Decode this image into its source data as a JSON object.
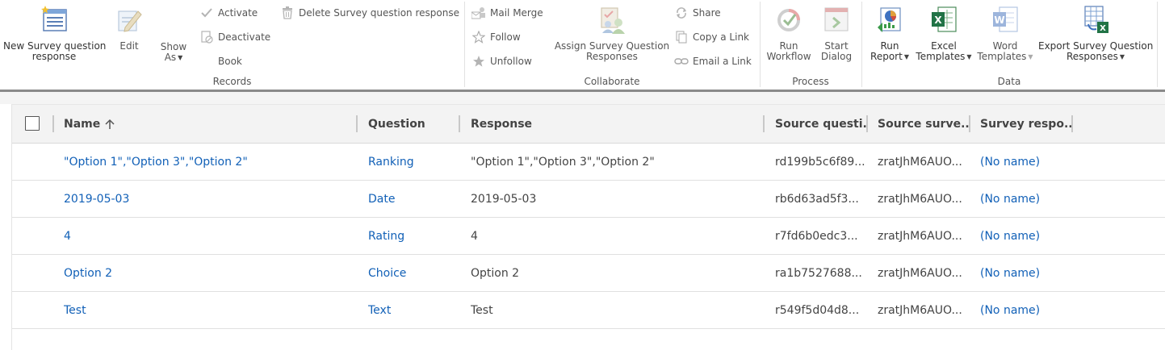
{
  "ribbon": {
    "records": {
      "new_label_line1": "New Survey question",
      "new_label_line2": "response",
      "edit_label": "Edit",
      "show_as_line1": "Show",
      "show_as_line2": "As",
      "activate_label": "Activate",
      "deactivate_label": "Deactivate",
      "book_label": "Book",
      "delete_label": "Delete Survey question response",
      "group_label": "Records"
    },
    "collaborate": {
      "mail_merge_label": "Mail Merge",
      "follow_label": "Follow",
      "unfollow_label": "Unfollow",
      "assign_line1": "Assign Survey Question",
      "assign_line2": "Responses",
      "share_label": "Share",
      "copy_link_label": "Copy a Link",
      "email_link_label": "Email a Link",
      "group_label": "Collaborate"
    },
    "process": {
      "run_workflow_line1": "Run",
      "run_workflow_line2": "Workflow",
      "start_dialog_line1": "Start",
      "start_dialog_line2": "Dialog",
      "group_label": "Process"
    },
    "data": {
      "run_report_line1": "Run",
      "run_report_line2": "Report",
      "excel_line1": "Excel",
      "excel_line2": "Templates",
      "word_line1": "Word",
      "word_line2": "Templates",
      "export_line1": "Export Survey Question",
      "export_line2": "Responses",
      "group_label": "Data"
    }
  },
  "grid": {
    "columns": {
      "name": "Name",
      "question": "Question",
      "response": "Response",
      "source_question": "Source questi...",
      "source_survey": "Source surve...",
      "survey_response": "Survey respo..."
    },
    "sort_icon": "arrow-up-icon",
    "rows": [
      {
        "name": "\"Option 1\",\"Option 3\",\"Option 2\"",
        "question": "Ranking",
        "response": "\"Option 1\",\"Option 3\",\"Option 2\"",
        "source_question": "rd199b5c6f89...",
        "source_survey": "zratJhM6AUO...",
        "survey_response": "(No name)"
      },
      {
        "name": "2019-05-03",
        "question": "Date",
        "response": "2019-05-03",
        "source_question": "rb6d63ad5f3...",
        "source_survey": "zratJhM6AUO...",
        "survey_response": "(No name)"
      },
      {
        "name": "4",
        "question": "Rating",
        "response": "4",
        "source_question": "r7fd6b0edc3...",
        "source_survey": "zratJhM6AUO...",
        "survey_response": "(No name)"
      },
      {
        "name": "Option 2",
        "question": "Choice",
        "response": "Option 2",
        "source_question": "ra1b7527688...",
        "source_survey": "zratJhM6AUO...",
        "survey_response": "(No name)"
      },
      {
        "name": "Test",
        "question": "Text",
        "response": "Test",
        "source_question": "r549f5d04d8...",
        "source_survey": "zratJhM6AUO...",
        "survey_response": "(No name)"
      }
    ]
  },
  "colors": {
    "link": "#1160b7",
    "ribbon_border": "#8a8a8a",
    "header_bg": "#f3f3f3"
  }
}
